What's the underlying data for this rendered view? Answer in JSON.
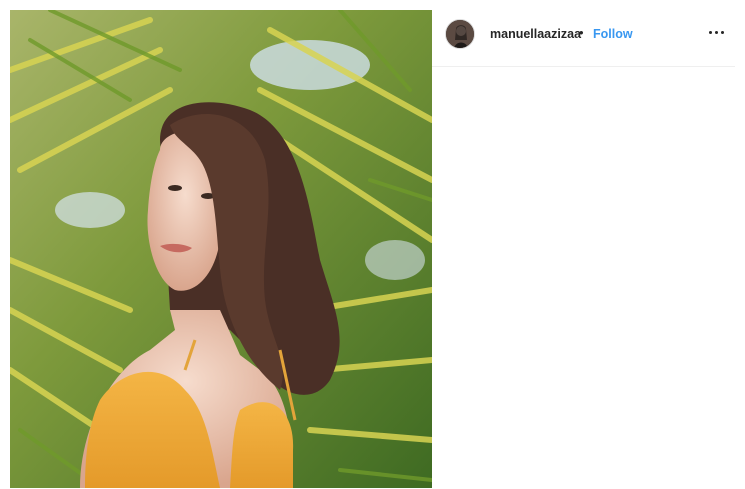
{
  "post": {
    "image_alt": "Portrait of a young woman with long dark hair in a yellow top in front of palm leaves"
  },
  "header": {
    "username": "manuellaazizaa",
    "separator": "•",
    "follow_label": "Follow",
    "avatar_icon": "profile-avatar",
    "more_icon": "more-options-icon"
  },
  "colors": {
    "follow": "#3897f0",
    "text": "#262626",
    "border": "#efefef"
  }
}
